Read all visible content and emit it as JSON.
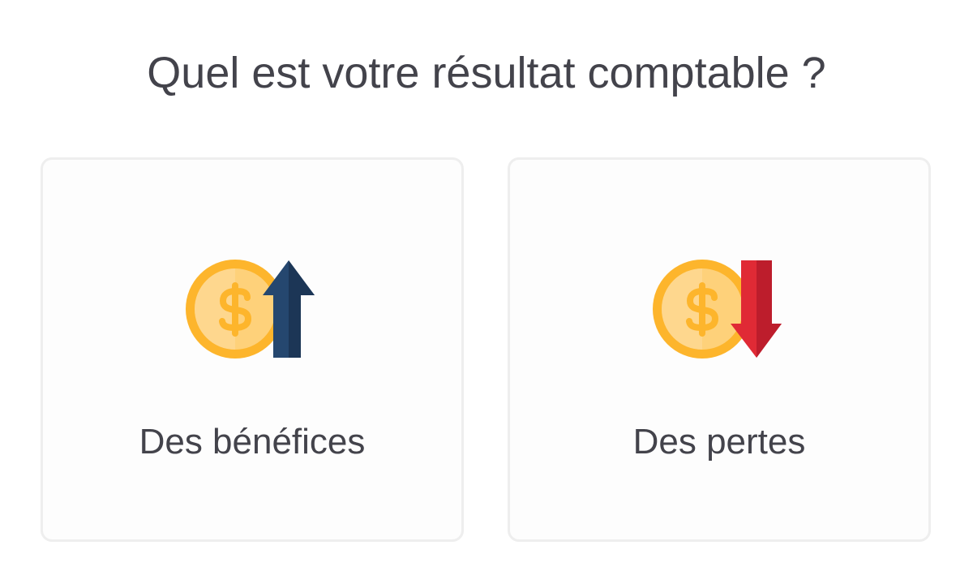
{
  "question": {
    "title": "Quel est votre résultat comptable ?"
  },
  "options": [
    {
      "label": "Des bénéfices",
      "icon": "coin-arrow-up-icon",
      "arrow_color": "#25476f",
      "arrow_shade": "#1c3656"
    },
    {
      "label": "Des pertes",
      "icon": "coin-arrow-down-icon",
      "arrow_color": "#e02a35",
      "arrow_shade": "#bd1d2c"
    }
  ],
  "colors": {
    "text": "#43434b",
    "card_border": "#eeeeee",
    "coin_outer": "#fdb52c",
    "coin_inner": "#fed17a",
    "coin_symbol": "#fdb52c"
  }
}
